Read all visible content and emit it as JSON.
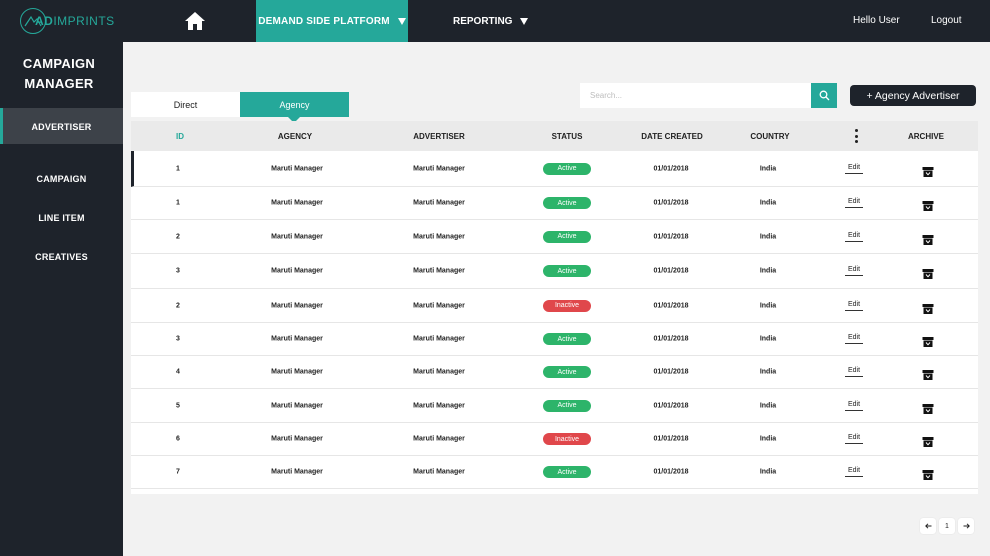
{
  "brand": {
    "logo_bold": "AD",
    "logo_light": "IMPRINTS",
    "accent_color": "#25a89a",
    "dark_color": "#1e232b"
  },
  "topnav": {
    "home_icon": "home-icon",
    "dsp_label": "DEMAND SIDE PLATFORM",
    "reporting_label": "REPORTING",
    "hello_label": "Hello User",
    "logout_label": "Logout"
  },
  "sidebar": {
    "title_line1": "CAMPAIGN",
    "title_line2": "MANAGER",
    "items": [
      {
        "label": "ADVERTISER",
        "active": true
      },
      {
        "label": "CAMPAIGN"
      },
      {
        "label": "LINE ITEM"
      },
      {
        "label": "CREATIVES"
      }
    ]
  },
  "tabs": [
    {
      "label": "Direct"
    },
    {
      "label": "Agency",
      "active": true
    }
  ],
  "search": {
    "placeholder": "Search..."
  },
  "add_button_label": "+ Agency Advertiser",
  "table": {
    "columns": [
      "ID",
      "AGENCY",
      "ADVERTISER",
      "STATUS",
      "DATE CREATED",
      "COUNTRY",
      "",
      "ARCHIVE"
    ],
    "edit_label": "Edit",
    "status_colors": {
      "Active": "#2db46a",
      "Inactive": "#e0474b"
    },
    "rows": [
      {
        "id": "1",
        "agency": "Maruti Manager",
        "advertiser": "Maruti Manager",
        "status": "Active",
        "date": "01/01/2018",
        "country": "India"
      },
      {
        "id": "1",
        "agency": "Maruti Manager",
        "advertiser": "Maruti Manager",
        "status": "Active",
        "date": "01/01/2018",
        "country": "India"
      },
      {
        "id": "2",
        "agency": "Maruti Manager",
        "advertiser": "Maruti Manager",
        "status": "Active",
        "date": "01/01/2018",
        "country": "India"
      },
      {
        "id": "3",
        "agency": "Maruti Manager",
        "advertiser": "Maruti Manager",
        "status": "Active",
        "date": "01/01/2018",
        "country": "India"
      },
      {
        "id": "2",
        "agency": "Maruti Manager",
        "advertiser": "Maruti Manager",
        "status": "Inactive",
        "date": "01/01/2018",
        "country": "India"
      },
      {
        "id": "3",
        "agency": "Maruti Manager",
        "advertiser": "Maruti Manager",
        "status": "Active",
        "date": "01/01/2018",
        "country": "India"
      },
      {
        "id": "4",
        "agency": "Maruti Manager",
        "advertiser": "Maruti Manager",
        "status": "Active",
        "date": "01/01/2018",
        "country": "India"
      },
      {
        "id": "5",
        "agency": "Maruti Manager",
        "advertiser": "Maruti Manager",
        "status": "Active",
        "date": "01/01/2018",
        "country": "India"
      },
      {
        "id": "6",
        "agency": "Maruti Manager",
        "advertiser": "Maruti Manager",
        "status": "Inactive",
        "date": "01/01/2018",
        "country": "India"
      },
      {
        "id": "7",
        "agency": "Maruti Manager",
        "advertiser": "Maruti Manager",
        "status": "Active",
        "date": "01/01/2018",
        "country": "India"
      }
    ]
  },
  "pagination": {
    "prev_icon": "arrow-left-icon",
    "current_page": "1",
    "next_icon": "arrow-right-icon"
  }
}
